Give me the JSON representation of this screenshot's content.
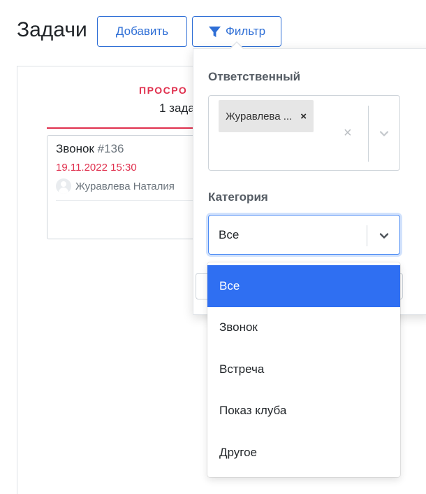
{
  "header": {
    "title": "Задачи",
    "add_label": "Добавить",
    "filter_label": "Фильтр"
  },
  "board": {
    "column": {
      "title": "ПРОСРО",
      "count": "1 зада"
    },
    "task": {
      "name": "Звонок",
      "number": "#136",
      "date": "19.11.2022 15:30",
      "assignee": "Журавлева Наталия"
    }
  },
  "filter": {
    "responsible_label": "Ответственный",
    "responsible_chip": "Журавлева ...",
    "chip_remove": "×",
    "clear_all": "×",
    "category_label": "Категория",
    "category_value": "Все",
    "category_options": [
      "Все",
      "Звонок",
      "Встреча",
      "Показ клуба",
      "Другое"
    ],
    "selected_index": 0
  },
  "colors": {
    "accent": "#2f6fd6",
    "overdue": "#e0304e",
    "selected_option": "#2f6ff2"
  }
}
